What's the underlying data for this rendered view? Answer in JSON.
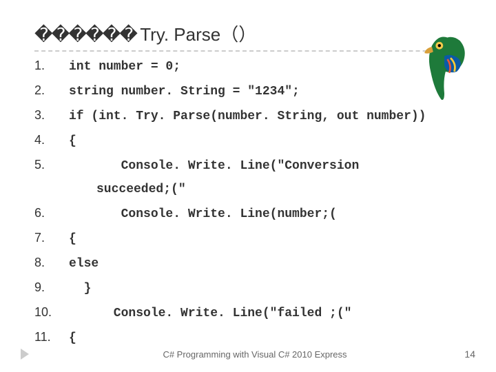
{
  "title_prefix": "������ ",
  "title_main": "Try. Parse（）",
  "lines": [
    {
      "n": "1.",
      "c": "int number = 0;"
    },
    {
      "n": "2.",
      "c": "string number. String = \"1234\";"
    },
    {
      "n": "3.",
      "c": "if (int. Try. Parse(number. String, out number))"
    },
    {
      "n": "4.",
      "c": "{"
    },
    {
      "n": "5.",
      "c": "       Console. Write. Line(\"Conversion"
    },
    {
      "n": "",
      "c": "succeeded;(\""
    },
    {
      "n": "6.",
      "c": "       Console. Write. Line(number;("
    },
    {
      "n": "7.",
      "c": "{"
    },
    {
      "n": "8.",
      "c": "else"
    },
    {
      "n": "9.",
      "c": "  }"
    },
    {
      "n": "10.",
      "c": "      Console. Write. Line(\"failed ;(\""
    },
    {
      "n": "11.",
      "c": "{"
    }
  ],
  "footer": "C# Programming with Visual C# 2010 Express",
  "page_number": "14",
  "parrot_colors": {
    "body": "#1e7a3a",
    "wing": "#0b5aa6",
    "beak": "#d9a03a",
    "eye": "#f2c84b",
    "pupil": "#000"
  }
}
